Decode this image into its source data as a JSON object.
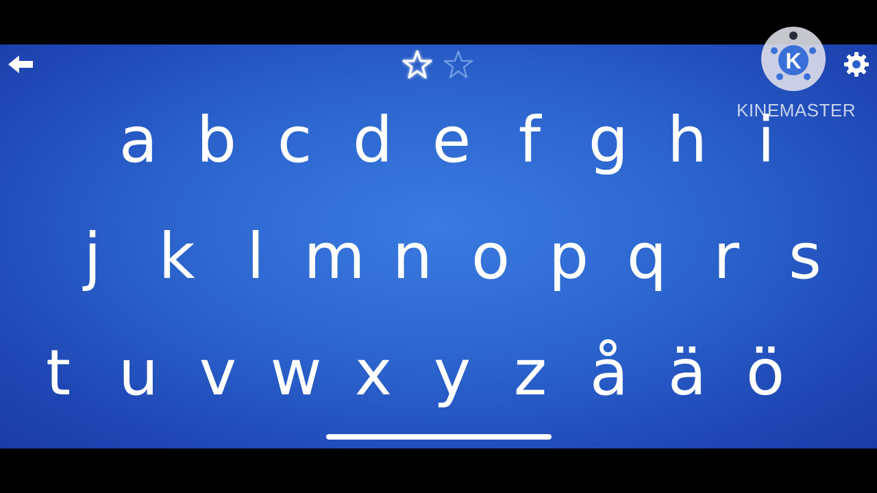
{
  "screen": {
    "background_color": "#2b63cc",
    "text_color": "#ffffff"
  },
  "toolbar": {
    "back_icon": "arrow-left-icon",
    "settings_icon": "gear-icon"
  },
  "stars": {
    "earned": 1,
    "total": 2
  },
  "alphabet": {
    "rows": [
      [
        "a",
        "b",
        "c",
        "d",
        "e",
        "f",
        "g",
        "h",
        "i"
      ],
      [
        "j",
        "k",
        "l",
        "m",
        "n",
        "o",
        "p",
        "q",
        "r",
        "s"
      ],
      [
        "t",
        "u",
        "v",
        "w",
        "x",
        "y",
        "z",
        "å",
        "ä",
        "ö"
      ]
    ]
  },
  "progress": {
    "value": 1.0
  },
  "watermark": {
    "text": "KINEMASTER",
    "logo_letter": "K"
  }
}
